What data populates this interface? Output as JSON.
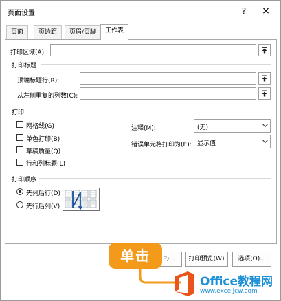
{
  "window": {
    "title": "页面设置",
    "help": "?",
    "close": "×"
  },
  "tabs": [
    "页面",
    "页边距",
    "页眉/页脚",
    "工作表"
  ],
  "print_area": {
    "label": "打印区域(A):",
    "value": ""
  },
  "print_titles": {
    "group": "打印标题",
    "rows_label": "顶端标题行(R):",
    "rows_value": "",
    "cols_label": "从左侧重复的列数(C):",
    "cols_value": ""
  },
  "print": {
    "group": "打印",
    "checkboxes": [
      "网格线(G)",
      "单色打印(B)",
      "草稿质量(Q)",
      "行和列标题(L)"
    ],
    "comments_label": "注释(M):",
    "comments_value": "(无)",
    "errors_label": "错误单元格打印为(E):",
    "errors_value": "显示值"
  },
  "order": {
    "group": "打印顺序",
    "options": [
      "先列后行(D)",
      "先行后列(V)"
    ],
    "selected": 0
  },
  "buttons": {
    "print": "P)...",
    "preview": "打印预览(W)",
    "options": "选项(O)..."
  },
  "callout": "单击",
  "watermark": {
    "brand": "Office教程网",
    "url": "www.exceljcw.com"
  },
  "colors": {
    "accent": "#f39a1b",
    "watermark": "#1c8fd6",
    "logo": "#e8541a"
  }
}
